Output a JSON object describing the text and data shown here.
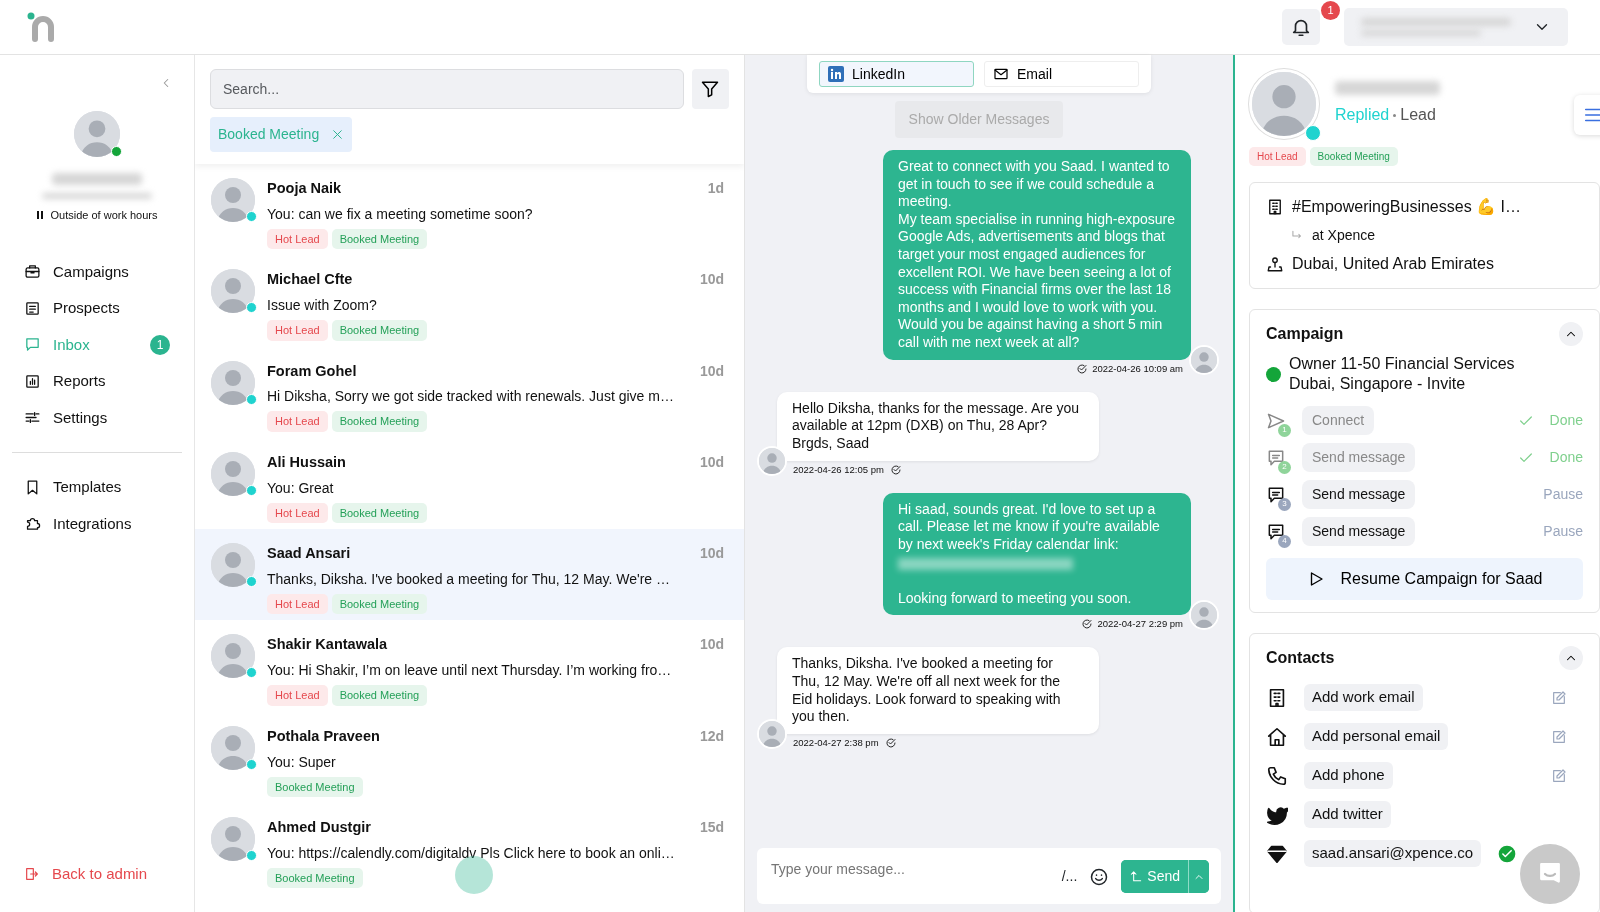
{
  "header": {
    "notification_count": "1"
  },
  "sidebar": {
    "status": "Outside of work hours",
    "online": true,
    "nav": [
      {
        "label": "Campaigns",
        "selected": false
      },
      {
        "label": "Prospects",
        "selected": false
      },
      {
        "label": "Inbox",
        "selected": true,
        "badge": "1"
      },
      {
        "label": "Reports",
        "selected": false
      },
      {
        "label": "Settings",
        "selected": false
      }
    ],
    "nav_secondary": [
      {
        "label": "Templates",
        "selected": false
      },
      {
        "label": "Integrations",
        "selected": false
      }
    ],
    "back_link": "Back to admin"
  },
  "list": {
    "search_placeholder": "Search...",
    "filter_chip": "Booked Meeting",
    "conversations": [
      {
        "name": "Pooja Naik",
        "preview": "You: can we fix a meeting sometime soon?",
        "age": "1d",
        "online": true,
        "selected": false,
        "tags": [
          {
            "label": "Hot Lead",
            "kind": "hot"
          },
          {
            "label": "Booked Meeting",
            "kind": "booked"
          }
        ]
      },
      {
        "name": "Michael Cfte",
        "preview": "Issue with Zoom?",
        "age": "10d",
        "online": true,
        "selected": false,
        "tags": [
          {
            "label": "Hot Lead",
            "kind": "hot"
          },
          {
            "label": "Booked Meeting",
            "kind": "booked"
          }
        ]
      },
      {
        "name": "Foram Gohel",
        "preview": "Hi Diksha, Sorry we got side tracked with renewals. Just give m…",
        "age": "10d",
        "online": true,
        "selected": false,
        "tags": [
          {
            "label": "Hot Lead",
            "kind": "hot"
          },
          {
            "label": "Booked Meeting",
            "kind": "booked"
          }
        ]
      },
      {
        "name": "Ali Hussain",
        "preview": "You: Great",
        "age": "10d",
        "online": true,
        "selected": false,
        "tags": [
          {
            "label": "Hot Lead",
            "kind": "hot"
          },
          {
            "label": "Booked Meeting",
            "kind": "booked"
          }
        ]
      },
      {
        "name": "Saad Ansari",
        "preview": "Thanks, Diksha. I've booked a meeting for Thu, 12 May. We're …",
        "age": "10d",
        "online": true,
        "selected": true,
        "tags": [
          {
            "label": "Hot Lead",
            "kind": "hot"
          },
          {
            "label": "Booked Meeting",
            "kind": "booked"
          }
        ]
      },
      {
        "name": "Shakir Kantawala",
        "preview": "You: Hi Shakir, I’m on leave until next Thursday. I’m working fro…",
        "age": "10d",
        "online": true,
        "selected": false,
        "tags": [
          {
            "label": "Hot Lead",
            "kind": "hot"
          },
          {
            "label": "Booked Meeting",
            "kind": "booked"
          }
        ]
      },
      {
        "name": "Pothala Praveen",
        "preview": "You: Super",
        "age": "12d",
        "online": true,
        "selected": false,
        "tags": [
          {
            "label": "Booked Meeting",
            "kind": "booked"
          }
        ]
      },
      {
        "name": "Ahmed Dustgir",
        "preview": "You: https://calendly.com/digitaldv Pls Click here to book an onli…",
        "age": "15d",
        "online": true,
        "selected": false,
        "tags": [
          {
            "label": "Booked Meeting",
            "kind": "booked"
          }
        ]
      }
    ]
  },
  "chat": {
    "channels": [
      {
        "label": "LinkedIn",
        "kind": "linkedin",
        "selected": true
      },
      {
        "label": "Email",
        "kind": "email",
        "selected": false
      }
    ],
    "older_button": "Show Older Messages",
    "messages": [
      {
        "kind": "sent",
        "time": "2022-04-26 10:09 am",
        "parts": [
          {
            "kind": "text",
            "text": "Great to connect with you Saad. I wanted to get in touch to see if we could schedule a meeting.\nMy team specialise in running high-exposure Google Ads, advertisements and blogs that target your most engaged audiences for excellent ROI. We have been seeing a lot of success with Financial firms over the last 18 months and I would love to work with you.\nWould you be against having a short 5 min call with me next week at all?"
          }
        ]
      },
      {
        "kind": "received",
        "time": "2022-04-26 12:05 pm",
        "parts": [
          {
            "kind": "text",
            "text": "Hello Diksha, thanks for the message. Are you available at 12pm (DXB) on Thu, 28 Apr?\nBrgds, Saad"
          }
        ]
      },
      {
        "kind": "sent",
        "time": "2022-04-27 2:29 pm",
        "parts": [
          {
            "kind": "text",
            "text": "Hi saad, sounds great. I'd love to set up a call. Please let me know if you're available by next week's Friday calendar link:"
          },
          {
            "kind": "redacted"
          },
          {
            "kind": "text",
            "text": "Looking forward to meeting you soon."
          }
        ]
      },
      {
        "kind": "received",
        "time": "2022-04-27 2:38 pm",
        "parts": [
          {
            "kind": "text",
            "text": "Thanks, Diksha. I've booked a meeting for Thu, 12 May. We're off all next week for the Eid holidays. Look forward to speaking with you then."
          }
        ]
      }
    ],
    "composer_placeholder": "Type your message...",
    "shortcut": "/...",
    "send": "Send"
  },
  "profile": {
    "status": "Replied",
    "role": "Lead",
    "online": true,
    "tags": [
      {
        "label": "Hot Lead",
        "kind": "hot"
      },
      {
        "label": "Booked Meeting",
        "kind": "booked"
      }
    ],
    "headline": "#EmpoweringBusinesses 💪 I…",
    "company": "at Xpence",
    "location": "Dubai, United Arab Emirates",
    "campaign": {
      "title": "Campaign",
      "expanded": true,
      "name": "Owner 11-50 Financial Services Dubai, Singapore - Invite",
      "color": "#14a53a",
      "steps": [
        {
          "kind": "connect",
          "number": "1",
          "label": "Connect",
          "status": "Done",
          "done": true
        },
        {
          "kind": "message",
          "number": "2",
          "label": "Send message",
          "status": "Done",
          "done": true
        },
        {
          "kind": "message",
          "number": "3",
          "label": "Send message",
          "status": "Pause",
          "done": false
        },
        {
          "kind": "message",
          "number": "4",
          "label": "Send message",
          "status": "Pause",
          "done": false
        }
      ],
      "resume": "Resume Campaign for Saad"
    },
    "contacts": {
      "title": "Contacts",
      "expanded": true,
      "items": [
        {
          "kind": "building",
          "label": "Add work email",
          "editable": true,
          "verified": false
        },
        {
          "kind": "home",
          "label": "Add personal email",
          "editable": true,
          "verified": false
        },
        {
          "kind": "phone",
          "label": "Add phone",
          "editable": true,
          "verified": false
        },
        {
          "kind": "bird",
          "label": "Add twitter",
          "editable": false,
          "verified": false
        },
        {
          "kind": "gem",
          "label": "saad.ansari@xpence.co",
          "editable": false,
          "verified": true
        }
      ]
    }
  }
}
